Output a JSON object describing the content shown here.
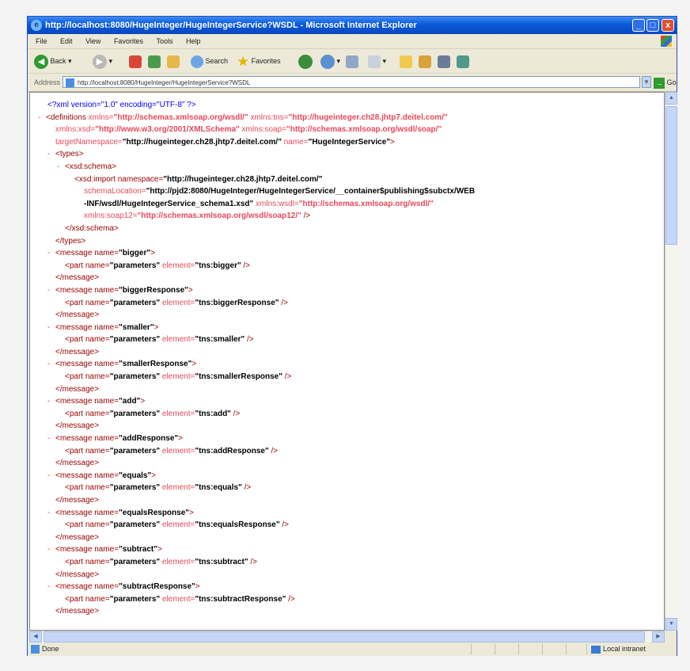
{
  "window": {
    "title": "http://localhost:8080/HugeInteger/HugeIntegerService?WSDL - Microsoft Internet Explorer",
    "minimize": "_",
    "maximize": "□",
    "close": "x"
  },
  "menu": [
    "File",
    "Edit",
    "View",
    "Favorites",
    "Tools",
    "Help"
  ],
  "toolbar": {
    "back": "Back",
    "search": "Search",
    "favorites": "Favorites"
  },
  "address": {
    "label": "Address",
    "url": "http://localhost:8080/HugeInteger/HugeIntegerService?WSDL",
    "go": "Go"
  },
  "xml": {
    "decl": "<?xml version=\"1.0\" encoding=\"UTF-8\" ?>",
    "definitions": {
      "open": "<definitions",
      "xmlns_attr": " xmlns=",
      "xmlns_val": "\"http://schemas.xmlsoap.org/wsdl/\"",
      "tns_attr": " xmlns:tns=",
      "tns_val": "\"http://hugeinteger.ch28.jhtp7.deitel.com/\"",
      "xsd_attr": "xmlns:xsd=",
      "xsd_val": "\"http://www.w3.org/2001/XMLSchema\"",
      "soap_attr": " xmlns:soap=",
      "soap_val": "\"http://schemas.xmlsoap.org/wsdl/soap/\"",
      "target_attr": "targetNamespace=",
      "target_val": "\"http://hugeinteger.ch28.jhtp7.deitel.com/\"",
      "name_attr": " name=",
      "name_val": "\"HugeIntegerService\"",
      "end": ">"
    },
    "types_open": "<types>",
    "schema_open": "<xsd:schema>",
    "import": {
      "open": "<xsd:import namespace=",
      "ns_val": "\"http://hugeinteger.ch28.jhtp7.deitel.com/\"",
      "loc_attr": "schemaLocation=",
      "loc_val1": "\"http://pjd2:8080/HugeInteger/HugeIntegerService/__container$publishing$subctx/WEB",
      "loc_val2": "-INF/wsdl/HugeIntegerService_schema1.xsd\"",
      "wsdl_attr": " xmlns:wsdl=",
      "wsdl_val": "\"http://schemas.xmlsoap.org/wsdl/\"",
      "soap12_attr": "xmlns:soap12=",
      "soap12_val": "\"http://schemas.xmlsoap.org/wsdl/soap12/\"",
      "end": " />"
    },
    "schema_close": "</xsd:schema>",
    "types_close": "</types>",
    "message_close": "</message>",
    "messages": [
      {
        "name": "\"bigger\"",
        "element": "\"tns:bigger\""
      },
      {
        "name": "\"biggerResponse\"",
        "element": "\"tns:biggerResponse\""
      },
      {
        "name": "\"smaller\"",
        "element": "\"tns:smaller\""
      },
      {
        "name": "\"smallerResponse\"",
        "element": "\"tns:smallerResponse\""
      },
      {
        "name": "\"add\"",
        "element": "\"tns:add\""
      },
      {
        "name": "\"addResponse\"",
        "element": "\"tns:addResponse\""
      },
      {
        "name": "\"equals\"",
        "element": "\"tns:equals\""
      },
      {
        "name": "\"equalsResponse\"",
        "element": "\"tns:equalsResponse\""
      },
      {
        "name": "\"subtract\"",
        "element": "\"tns:subtract\""
      },
      {
        "name": "\"subtractResponse\"",
        "element": "\"tns:subtractResponse\""
      }
    ],
    "message_open": "<message name=",
    "part_open": "<part name=",
    "part_name_val": "\"parameters\"",
    "element_attr": " element=",
    "part_end": " />",
    "tag_end": ">"
  },
  "status": {
    "text": "Done",
    "zone": "Local intranet"
  }
}
